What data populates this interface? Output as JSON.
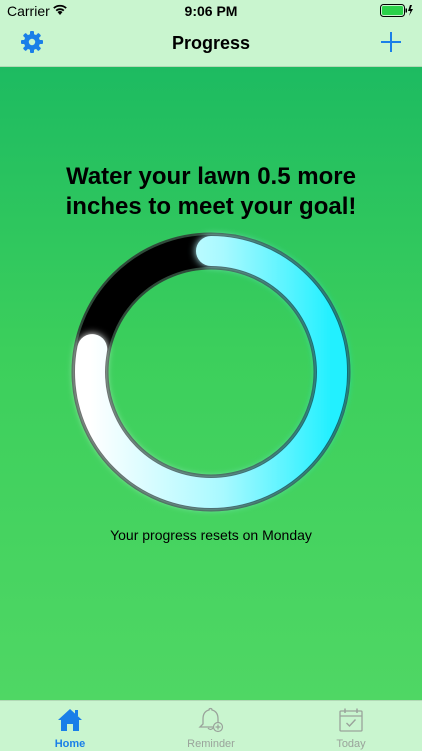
{
  "status_bar": {
    "carrier": "Carrier",
    "time": "9:06 PM"
  },
  "nav": {
    "title": "Progress",
    "settings_icon": "gear-icon",
    "add_icon": "plus-icon"
  },
  "main": {
    "headline_line1": "Water your lawn 0.5 more",
    "headline_line2": "inches to meet your goal!",
    "progress_fraction": 0.78,
    "reset_text": "Your progress resets on Monday"
  },
  "tabs": [
    {
      "label": "Home",
      "icon": "house-icon",
      "active": true
    },
    {
      "label": "Reminder",
      "icon": "bell-icon",
      "active": false
    },
    {
      "label": "Today",
      "icon": "calendar-icon",
      "active": false
    }
  ],
  "colors": {
    "accent": "#1a7fe8",
    "ring_start": "#ffffff",
    "ring_end": "#22f0ff",
    "ring_track": "#000000"
  }
}
